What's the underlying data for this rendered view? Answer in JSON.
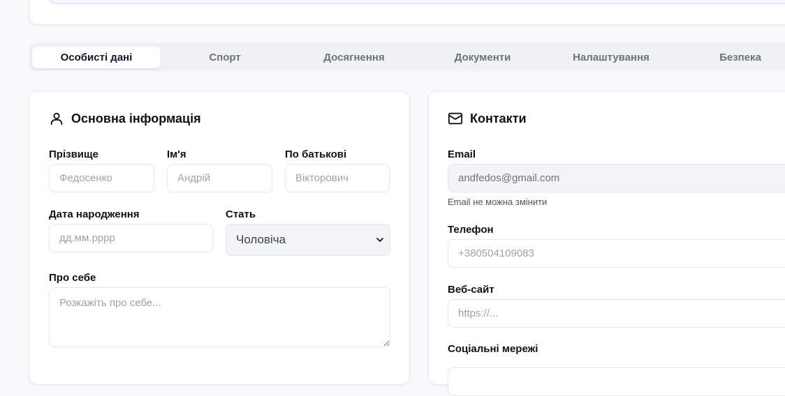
{
  "tabs": [
    {
      "label": "Особисті дані",
      "active": true
    },
    {
      "label": "Спорт",
      "active": false
    },
    {
      "label": "Досягнення",
      "active": false
    },
    {
      "label": "Документи",
      "active": false
    },
    {
      "label": "Налаштування",
      "active": false
    },
    {
      "label": "Безпека",
      "active": false
    }
  ],
  "basic": {
    "title": "Основна інформація",
    "title_icon": "user-icon",
    "last_name": {
      "label": "Прізвище",
      "placeholder": "Федосенко"
    },
    "first_name": {
      "label": "Ім'я",
      "placeholder": "Андрій"
    },
    "patronymic": {
      "label": "По батькові",
      "placeholder": "Вікторович"
    },
    "birth_date": {
      "label": "Дата народження",
      "placeholder": "дд.мм.рррр"
    },
    "gender": {
      "label": "Стать",
      "value": "Чоловіча"
    },
    "about": {
      "label": "Про себе",
      "placeholder": "Розкажіть про себе..."
    }
  },
  "contacts": {
    "title": "Контакти",
    "title_icon": "mail-icon",
    "email": {
      "label": "Email",
      "value": "andfedos@gmail.com",
      "help": "Email не можна змінити"
    },
    "phone": {
      "label": "Телефон",
      "placeholder": "+380504109083"
    },
    "website": {
      "label": "Веб-сайт",
      "placeholder": "https://..."
    },
    "social": {
      "label": "Соціальні мережі"
    }
  }
}
